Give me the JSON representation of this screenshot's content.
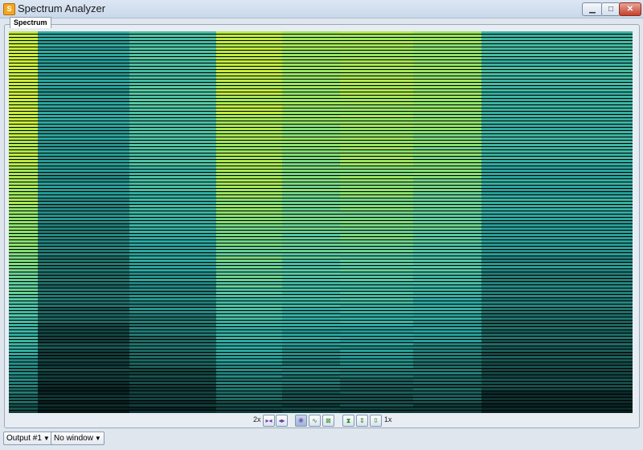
{
  "window": {
    "title": "Spectrum Analyzer",
    "icon": "spectrum-app-icon",
    "controls": [
      "minimize-icon",
      "maximize-icon",
      "close-icon"
    ]
  },
  "tabs": [
    {
      "label": "Spectrum",
      "active": true
    }
  ],
  "spectrogram": {
    "colormap": [
      "#000000",
      "#0b2a2a",
      "#1f6b66",
      "#2aa6a0",
      "#57c8a4",
      "#8fe26a",
      "#c8ec3a",
      "#f0f040"
    ],
    "columns": [
      {
        "level": 0.86
      },
      {
        "level": 0.42
      },
      {
        "level": 0.55
      },
      {
        "level": 0.82
      },
      {
        "level": 0.74
      },
      {
        "level": 0.77
      },
      {
        "level": 0.72
      },
      {
        "level": 0.5
      }
    ]
  },
  "toolbar": {
    "zoom_x": "2x",
    "zoom_y": "1x",
    "buttons": [
      "zoom-in-x-icon",
      "zoom-out-x-icon",
      "spectrum-mode-icon",
      "waveform-mode-icon",
      "fit-icon",
      "zoom-in-y-icon",
      "scroll-y-icon",
      "zoom-out-y-icon"
    ]
  },
  "bottom": {
    "output_select": "Output #1",
    "window_select": "No window"
  }
}
